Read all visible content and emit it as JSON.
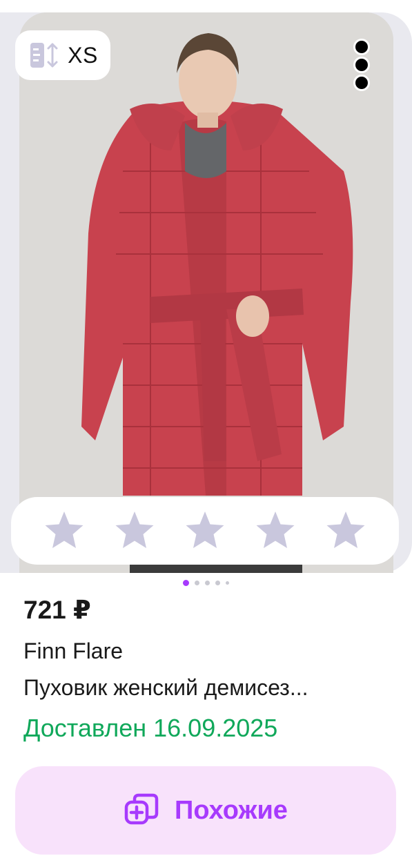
{
  "product": {
    "size_label": "XS",
    "price": "721 ₽",
    "brand": "Finn Flare",
    "title": "Пуховик женский демисез...",
    "status": "Доставлен 16.09.2025"
  },
  "rating": {
    "stars_total": 5,
    "stars_filled": 0,
    "star_color": "#c9c7dd"
  },
  "gallery": {
    "image_count": 5,
    "active_index": 0
  },
  "actions": {
    "similar_label": "Похожие"
  },
  "colors": {
    "accent": "#a73afd",
    "status_green": "#10a85a",
    "coat_red": "#c8424e"
  },
  "icons": [
    "size-icon",
    "more-icon",
    "star-icon",
    "similar-icon"
  ]
}
